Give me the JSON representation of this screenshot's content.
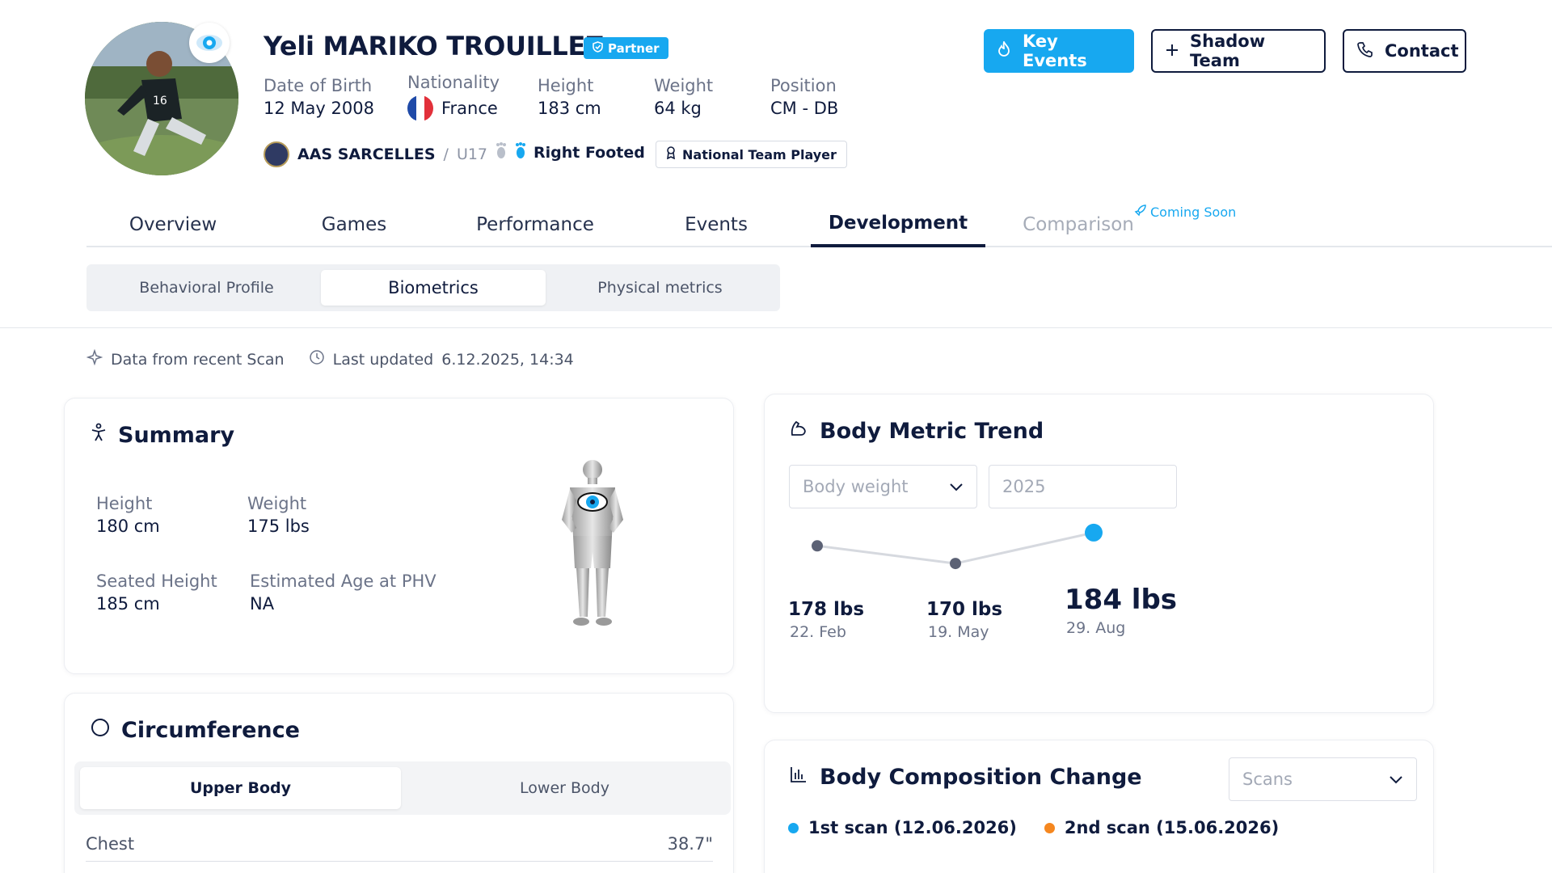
{
  "player": {
    "name": "Yeli MARIKO TROUILLEZ",
    "badge": "Partner",
    "dob_label": "Date of Birth",
    "dob": "12 May 2008",
    "nationality_label": "Nationality",
    "nationality": "France",
    "height_label": "Height",
    "height": "183 cm",
    "weight_label": "Weight",
    "weight": "64 kg",
    "position_label": "Position",
    "position": "CM - DB",
    "club": "AAS SARCELLES",
    "club_sep": "/",
    "team": "U17",
    "foot": "Right Footed",
    "national_tag": "National Team Player"
  },
  "actions": {
    "key_events": "Key Events",
    "shadow_team": "Shadow Team",
    "contact": "Contact"
  },
  "tabs": [
    {
      "label": "Overview"
    },
    {
      "label": "Games"
    },
    {
      "label": "Performance"
    },
    {
      "label": "Events"
    },
    {
      "label": "Development"
    },
    {
      "label": "Comparison"
    }
  ],
  "coming_soon": "Coming Soon",
  "subtabs": [
    {
      "label": "Behavioral Profile"
    },
    {
      "label": "Biometrics"
    },
    {
      "label": "Physical metrics"
    }
  ],
  "meta": {
    "scan": "Data from recent Scan",
    "updated_label": "Last updated",
    "updated_value": "6.12.2025, 14:34"
  },
  "summary": {
    "title": "Summary",
    "height_label": "Height",
    "height": "180 cm",
    "weight_label": "Weight",
    "weight": "175 lbs",
    "seated_label": "Seated Height",
    "seated": "185 cm",
    "phv_label": "Estimated Age at PHV",
    "phv": "NA"
  },
  "trend": {
    "title": "Body Metric Trend",
    "metric_select": "Body weight",
    "year_input": "2025"
  },
  "chart_data": {
    "type": "line",
    "x": [
      "22. Feb",
      "19. May",
      "29. Aug"
    ],
    "values": [
      178,
      170,
      184
    ],
    "value_labels": [
      "178 lbs",
      "170 lbs",
      "184 lbs"
    ],
    "highlight_index": 2,
    "colors": {
      "line": "#d6d9df",
      "point": "#5c6275",
      "highlight": "#17a8f0"
    }
  },
  "circumference": {
    "title": "Circumference",
    "tab_upper": "Upper Body",
    "tab_lower": "Lower Body",
    "chest_label": "Chest",
    "chest_value": "38.7\""
  },
  "composition": {
    "title": "Body Composition Change",
    "select": "Scans",
    "legend1": "1st scan (12.06.2026)",
    "legend2": "2nd scan (15.06.2026)",
    "color1": "#17a8f0",
    "color2": "#f5871f"
  }
}
